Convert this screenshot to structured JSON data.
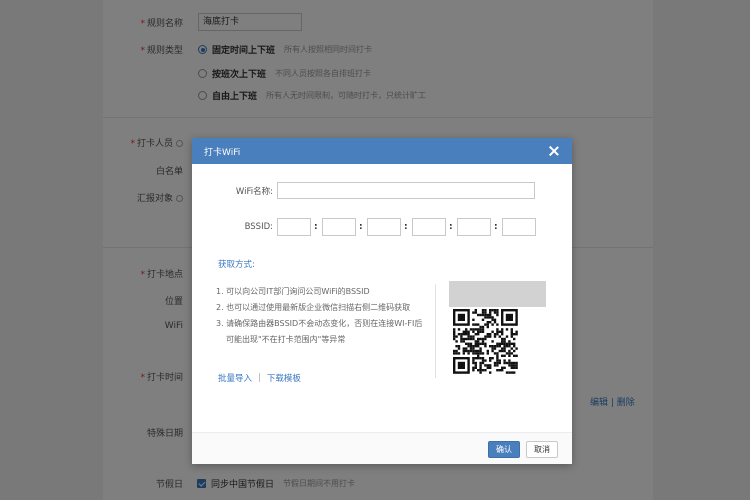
{
  "form": {
    "rule_name_label": "规则名称",
    "rule_name_value": "海底打卡",
    "rule_type_label": "规则类型",
    "rule_types": [
      {
        "name": "固定时间上下班",
        "desc": "所有人按照相同时间打卡"
      },
      {
        "name": "按班次上下班",
        "desc": "不同人员按照各自排班打卡"
      },
      {
        "name": "自由上下班",
        "desc": "所有人无时间限制，可随时打卡，只统计旷工"
      }
    ],
    "members_label": "打卡人员",
    "whitelist_label": "白名单",
    "report_label": "汇报对象",
    "location_label": "打卡地点",
    "position_label": "位置",
    "wifi_label": "WiFi",
    "time_label": "打卡时间",
    "edit_link": "编辑",
    "delete_link": "删除",
    "special_date_label": "特殊日期",
    "holiday_label": "节假日",
    "holiday_check_label": "同步中国节假日",
    "holiday_check_desc": "节假日期间不用打卡"
  },
  "modal": {
    "title": "打卡WiFi",
    "wifi_name_label": "WiFi名称:",
    "bssid_label": "BSSID:",
    "bssid_sep": ":",
    "method_title": "获取方式:",
    "steps": [
      "1. 可以向公司IT部门询问公司WiFi的BSSID",
      "2. 也可以通过使用最新版企业微信扫描右侧二维码获取",
      "3. 请确保路由器BSSID不会动态变化，否则在连接WI-FI后",
      "可能出现\"不在打卡范围内\"等异常"
    ],
    "batch_import": "批量导入",
    "link_sep": "|",
    "download_template": "下载模板",
    "confirm": "确认",
    "cancel": "取消"
  },
  "colors": {
    "accent": "#4a7fbd",
    "link": "#3a78c2"
  }
}
